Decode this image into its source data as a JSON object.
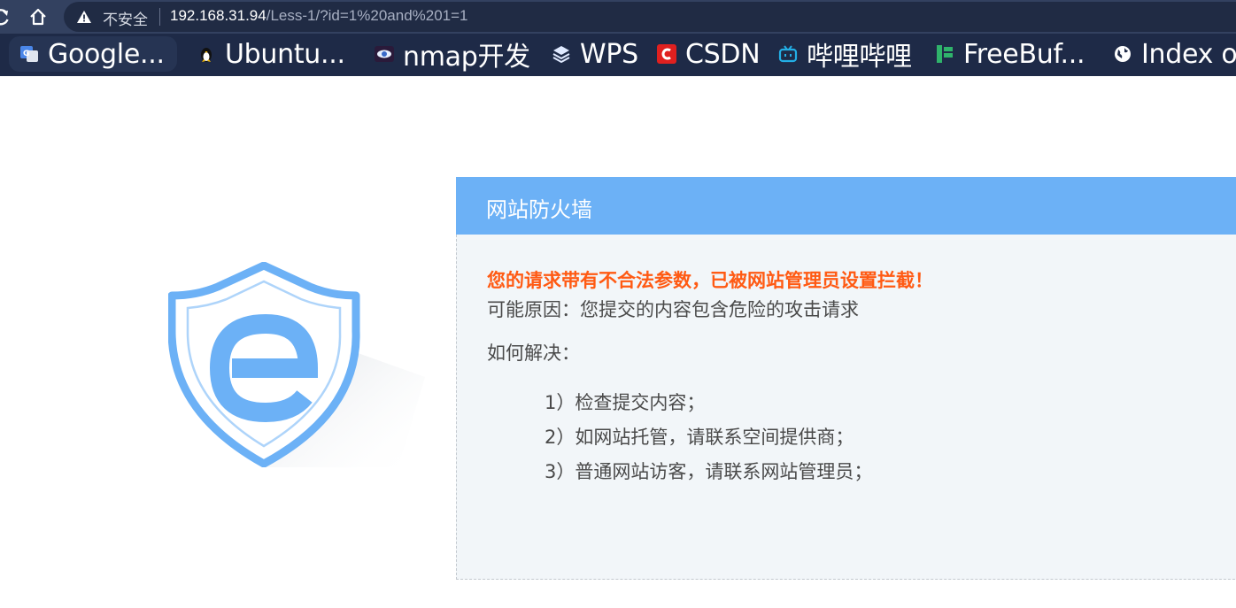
{
  "browser": {
    "security_label": "不安全",
    "url_host": "192.168.31.94",
    "url_path": "/Less-1/?id=1%20and%201=1"
  },
  "bookmarks": [
    {
      "label": "Google...",
      "icon": "google-translate-icon"
    },
    {
      "label": "Ubuntu...",
      "icon": "penguin-icon"
    },
    {
      "label": "nmap开发",
      "icon": "eye-icon"
    },
    {
      "label": "WPS",
      "icon": "layers-icon"
    },
    {
      "label": "CSDN",
      "icon": "csdn-icon"
    },
    {
      "label": "哔哩哔哩",
      "icon": "bilibili-icon"
    },
    {
      "label": "FreeBuf...",
      "icon": "freebuf-icon"
    },
    {
      "label": "Index o",
      "icon": "globe-icon"
    }
  ],
  "waf": {
    "title": "网站防火墙",
    "alert": "您的请求带有不合法参数，已被网站管理员设置拦截！",
    "reason": "可能原因：您提交的内容包含危险的攻击请求",
    "howto": "如何解决：",
    "steps": [
      "1）检查提交内容；",
      "2）如网站托管，请联系空间提供商；",
      "3）普通网站访客，请联系网站管理员；"
    ]
  },
  "colors": {
    "header_blue": "#6cb1f6",
    "alert_orange": "#ff5a13",
    "chrome_dark": "#334160"
  }
}
